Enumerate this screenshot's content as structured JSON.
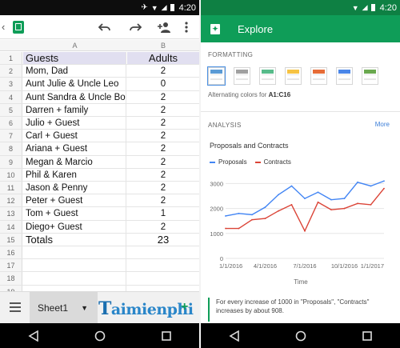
{
  "status_left": {
    "time": "4:20"
  },
  "status_right": {
    "time": "4:20"
  },
  "toolbar": {
    "back_icon": "back-arrow-icon",
    "app_icon": "sheets-icon",
    "undo_icon": "undo-icon",
    "redo_icon": "redo-icon",
    "share_icon": "add-person-icon",
    "more_icon": "more-vert-icon"
  },
  "sheet": {
    "columns": [
      "A",
      "B"
    ],
    "rows": [
      {
        "n": "1",
        "a": "Guests",
        "b": "Adults"
      },
      {
        "n": "2",
        "a": "Mom, Dad",
        "b": "2"
      },
      {
        "n": "3",
        "a": "Aunt Julie & Uncle Leo",
        "b": "0"
      },
      {
        "n": "4",
        "a": "Aunt Sandra & Uncle Bob",
        "b": "2"
      },
      {
        "n": "5",
        "a": "Darren + family",
        "b": "2"
      },
      {
        "n": "6",
        "a": "Julio + Guest",
        "b": "2"
      },
      {
        "n": "7",
        "a": "Carl + Guest",
        "b": "2"
      },
      {
        "n": "8",
        "a": "Ariana + Guest",
        "b": "2"
      },
      {
        "n": "9",
        "a": "Megan & Marcio",
        "b": "2"
      },
      {
        "n": "10",
        "a": "Phil & Karen",
        "b": "2"
      },
      {
        "n": "11",
        "a": "Jason & Penny",
        "b": "2"
      },
      {
        "n": "12",
        "a": "Peter + Guest",
        "b": "2"
      },
      {
        "n": "13",
        "a": "Tom + Guest",
        "b": "1"
      },
      {
        "n": "14",
        "a": "Diego+ Guest",
        "b": "2"
      },
      {
        "n": "15",
        "a": "Totals",
        "b": "23"
      },
      {
        "n": "16",
        "a": "",
        "b": ""
      },
      {
        "n": "17",
        "a": "",
        "b": ""
      },
      {
        "n": "18",
        "a": "",
        "b": ""
      },
      {
        "n": "19",
        "a": "",
        "b": ""
      }
    ],
    "tab_label": "Sheet1",
    "watermark": "aimienphi",
    "watermark_t": "T",
    "add_sheet": "+"
  },
  "explore": {
    "title": "Explore",
    "formatting_title": "FORMATTING",
    "swatch_colors": [
      "#5b9bd5",
      "#a0a0a0",
      "#57bb8a",
      "#f6c343",
      "#e66c37",
      "#4a86e8",
      "#6aa84f"
    ],
    "alt_colors_label": "Alternating colors for",
    "alt_colors_range": "A1:C16",
    "analysis_title": "ANALYSIS",
    "more_label": "More",
    "insight_text": "For every increase of 1000 in \"Proposals\", \"Contracts\" increases by about 908."
  },
  "chart_data": {
    "type": "line",
    "title": "Proposals and Contracts",
    "xlabel": "Time",
    "ylabel": "",
    "x_ticks": [
      "1/1/2016",
      "4/1/2016",
      "7/1/2016",
      "10/1/2016",
      "1/1/2017"
    ],
    "y_ticks": [
      0,
      1000,
      2000,
      3000
    ],
    "ylim": [
      0,
      3300
    ],
    "xlim": [
      0,
      12
    ],
    "legend_position": "top-left",
    "grid": true,
    "series": [
      {
        "name": "Proposals",
        "color": "#4285f4",
        "x": [
          0,
          1,
          2,
          3,
          4,
          5,
          6,
          7,
          8,
          9,
          10,
          11,
          12
        ],
        "values": [
          1700,
          1800,
          1750,
          2050,
          2550,
          2900,
          2400,
          2650,
          2350,
          2400,
          3050,
          2900,
          3100
        ]
      },
      {
        "name": "Contracts",
        "color": "#db4437",
        "x": [
          0,
          1,
          2,
          3,
          4,
          5,
          6,
          7,
          8,
          9,
          10,
          11,
          12
        ],
        "values": [
          1200,
          1200,
          1550,
          1600,
          1900,
          2150,
          1100,
          2250,
          1950,
          2000,
          2200,
          2150,
          2800
        ]
      }
    ]
  }
}
